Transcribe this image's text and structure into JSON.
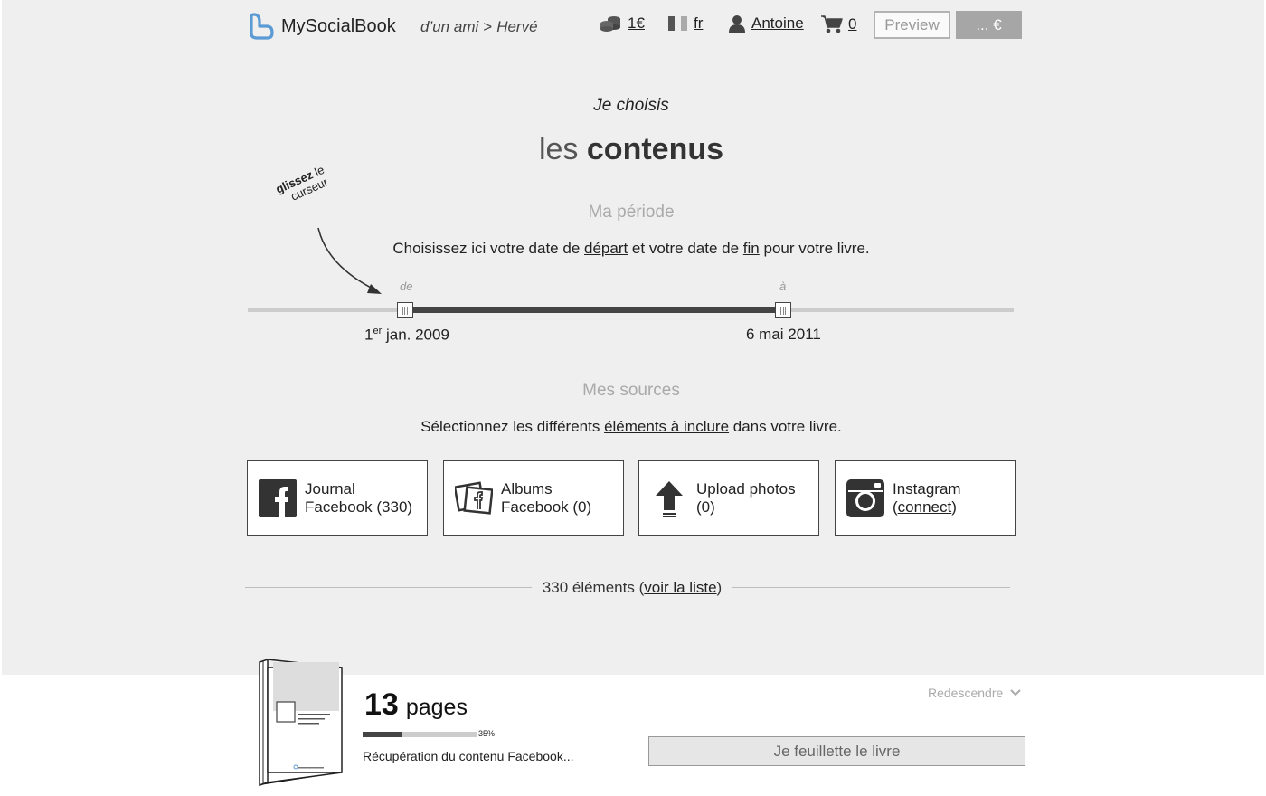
{
  "header": {
    "logo_text": "MySocialBook",
    "breadcrumb": {
      "item1": "d’un ami",
      "separator": ">",
      "item2": "Hervé"
    },
    "credits": "1€",
    "language": "fr",
    "user": "Antoine",
    "cart_count": "0",
    "preview_label": "Preview",
    "price_label": "... €"
  },
  "titles": {
    "kicker": "Je choisis",
    "title_light": "les",
    "title_bold": "contenus"
  },
  "period": {
    "heading": "Ma période",
    "text_before": "Choisissez ici votre date de ",
    "link_start": "départ",
    "text_middle": " et votre date de ",
    "link_end": "fin",
    "text_after": " pour votre livre.",
    "hint_bold": "glissez",
    "hint_rest1": "le",
    "hint_rest2": "curseur",
    "from_label": "de",
    "to_label": "à",
    "start_date_prefix": "1",
    "start_date_sup": "er",
    "start_date_suffix": " jan. 2009",
    "end_date": "6 mai 2011",
    "range": {
      "start_fraction": 0.205,
      "end_fraction": 0.699
    }
  },
  "sources": {
    "heading": "Mes sources",
    "text_before": "Sélectionnez les différents ",
    "link": "éléments à inclure",
    "text_after": " dans votre livre.",
    "cards": [
      {
        "line1": "Journal",
        "line2": "Facebook (330)",
        "icon": "facebook-icon"
      },
      {
        "line1": "Albums",
        "line2": "Facebook (0)",
        "icon": "facebook-album-icon"
      },
      {
        "line1": "Upload photos",
        "line2": "(0)",
        "icon": "upload-arrow-icon"
      },
      {
        "line1": "Instagram",
        "line2_pre": "(",
        "line2_link": "connect",
        "line2_post": ")",
        "icon": "instagram-icon"
      }
    ],
    "count_before": "330 éléments (",
    "count_link": "voir la liste",
    "count_after": ")"
  },
  "bottom": {
    "pages_number": "13",
    "pages_label": "pages",
    "progress_percent": 35,
    "progress_label": "35%",
    "status": "Récupération du contenu Facebook...",
    "collapse_label": "Redescendre",
    "browse_button": "Je feuillette le livre"
  },
  "colors": {
    "accent_blue": "#5b9bd5",
    "dark": "#444444",
    "background": "#efefef"
  }
}
